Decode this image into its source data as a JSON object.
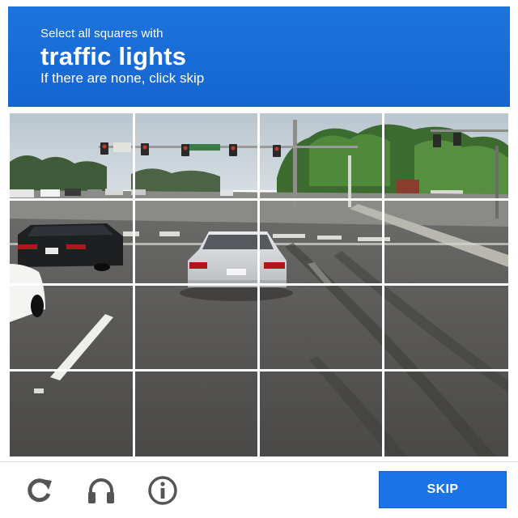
{
  "header": {
    "instruction": "Select all squares with",
    "target": "traffic lights",
    "hint": "If there are none, click skip"
  },
  "grid": {
    "rows": 4,
    "columns": 4,
    "tile_labels": [
      "Tile 1",
      "Tile 2",
      "Tile 3",
      "Tile 4",
      "Tile 5",
      "Tile 6",
      "Tile 7",
      "Tile 8",
      "Tile 9",
      "Tile 10",
      "Tile 11",
      "Tile 12",
      "Tile 13",
      "Tile 14",
      "Tile 15",
      "Tile 16"
    ]
  },
  "footer": {
    "reload_icon": "reload-icon",
    "audio_icon": "headphones-icon",
    "info_icon": "info-icon",
    "skip_label": "SKIP"
  },
  "colors": {
    "accent": "#1a73e8",
    "header_text": "#ffffff",
    "icon_gray": "#555555"
  }
}
